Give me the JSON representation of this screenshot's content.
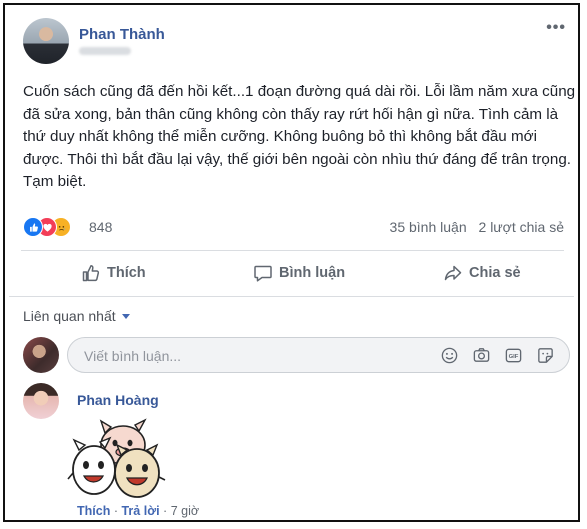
{
  "post": {
    "author": "Phan Thành",
    "text": "Cuốn sách cũng đã đến hồi kết...1 đoạn đường quá dài rồi. Lỗi lầm năm xưa cũng đã sửa xong, bản thân cũng không còn thấy ray rứt hối hận gì nữa. Tình cảm là thứ duy nhất không thể miễn cưỡng. Không buông bỏ thì không bắt đầu mới được. Thôi thì bắt đầu lại vậy, thế giới bên ngoài còn nhìu thứ đáng để trân trọng.\nTạm biệt.",
    "more_icon": "more-horizontal-icon"
  },
  "stats": {
    "reactions": [
      "like",
      "love",
      "sad"
    ],
    "reaction_count": "848",
    "comments": "35 bình luận",
    "shares": "2 lượt chia sẻ"
  },
  "actions": {
    "like_label": "Thích",
    "comment_label": "Bình luận",
    "share_label": "Chia sẻ"
  },
  "comments_section": {
    "sort_label": "Liên quan nhất",
    "composer_placeholder": "Viết bình luận...",
    "composer_icons": [
      "emoji-icon",
      "camera-icon",
      "gif-icon",
      "sticker-icon"
    ]
  },
  "comment": {
    "author": "Phan Hoàng",
    "like_label": "Thích",
    "reply_label": "Trả lời",
    "time": "7 giờ",
    "separator": "·"
  },
  "colors": {
    "link_blue": "#385898",
    "like_blue": "#1877f2",
    "love_red": "#f33e58",
    "sad_yellow": "#f7b125",
    "secondary_text": "#606770"
  }
}
